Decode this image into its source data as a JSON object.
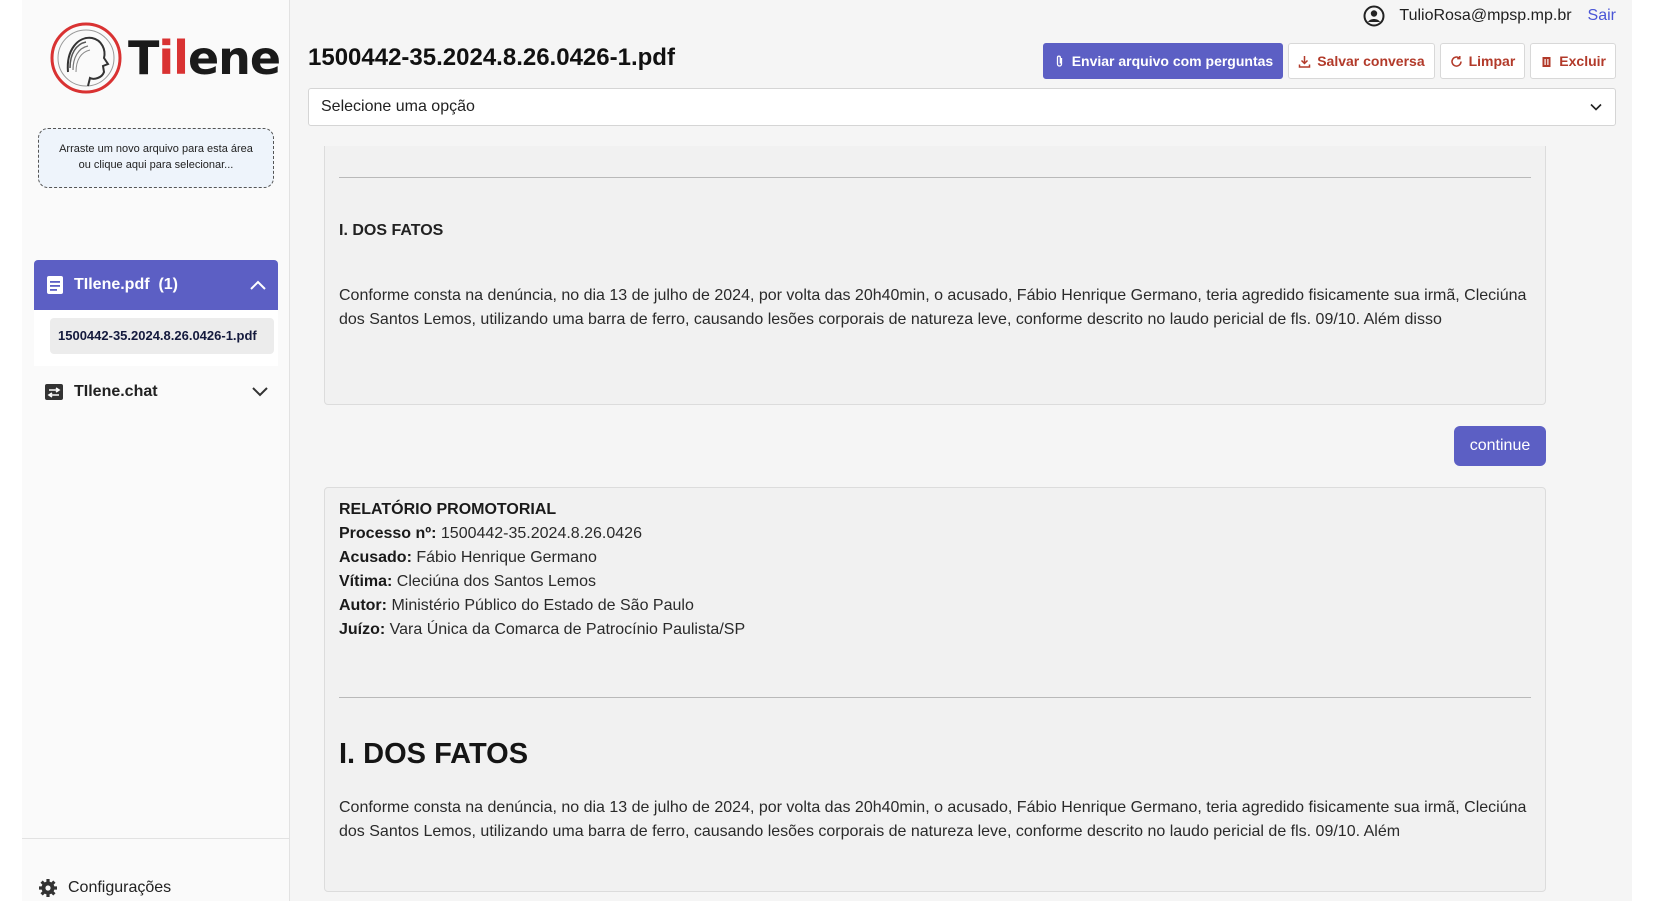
{
  "sidebar": {
    "logo": {
      "prefix": "T",
      "accent": "il",
      "rest": "ene"
    },
    "dropzone": {
      "line1": "Arraste um novo arquivo para esta área",
      "line2": "ou clique aqui para selecionar..."
    },
    "group": {
      "label": "TIlene.pdf",
      "count": "(1)",
      "expanded": true
    },
    "file": "1500442-35.2024.8.26.0426-1.pdf",
    "chat": {
      "label": "TIlene.chat"
    },
    "settings": {
      "label": "Configurações"
    }
  },
  "user": {
    "email": "TulioRosa@mpsp.mp.br",
    "logout": "Sair"
  },
  "header": {
    "title": "1500442-35.2024.8.26.0426-1.pdf"
  },
  "toolbar": {
    "send": "Enviar arquivo com perguntas",
    "save": "Salvar conversa",
    "clear": "Limpar",
    "delete": "Excluir"
  },
  "select": {
    "value": "Selecione uma opção"
  },
  "messages": {
    "m1": {
      "heading": "I. DOS FATOS",
      "text": "Conforme consta na denúncia, no dia 13 de julho de 2024, por volta das 20h40min, o acusado, Fábio Henrique Germano, teria agredido fisicamente sua irmã, Cleciúna dos Santos Lemos, utilizando uma barra de ferro, causando lesões corporais de natureza leve, conforme descrito no laudo pericial de fls. 09/10. Além disso"
    },
    "continue": "continue",
    "m2": {
      "title": "RELATÓRIO PROMOTORIAL",
      "fields": [
        {
          "k": "Processo nº:",
          "v": "1500442-35.2024.8.26.0426"
        },
        {
          "k": "Acusado:",
          "v": "Fábio Henrique Germano"
        },
        {
          "k": "Vítima:",
          "v": "Cleciúna dos Santos Lemos"
        },
        {
          "k": "Autor:",
          "v": "Ministério Público do Estado de São Paulo"
        },
        {
          "k": "Juízo:",
          "v": "Vara Única da Comarca de Patrocínio Paulista/SP"
        }
      ],
      "heading": "I. DOS FATOS",
      "text": "Conforme consta na denúncia, no dia 13 de julho de 2024, por volta das 20h40min, o acusado, Fábio Henrique Germano, teria agredido fisicamente sua irmã, Cleciúna dos Santos Lemos, utilizando uma barra de ferro, causando lesões corporais de natureza leve, conforme descrito no laudo pericial de fls. 09/10. Além"
    }
  },
  "colors": {
    "primary": "#5c5fc4",
    "danger": "#b23a2a",
    "brand_red": "#d93232",
    "link": "#4a55d6"
  }
}
